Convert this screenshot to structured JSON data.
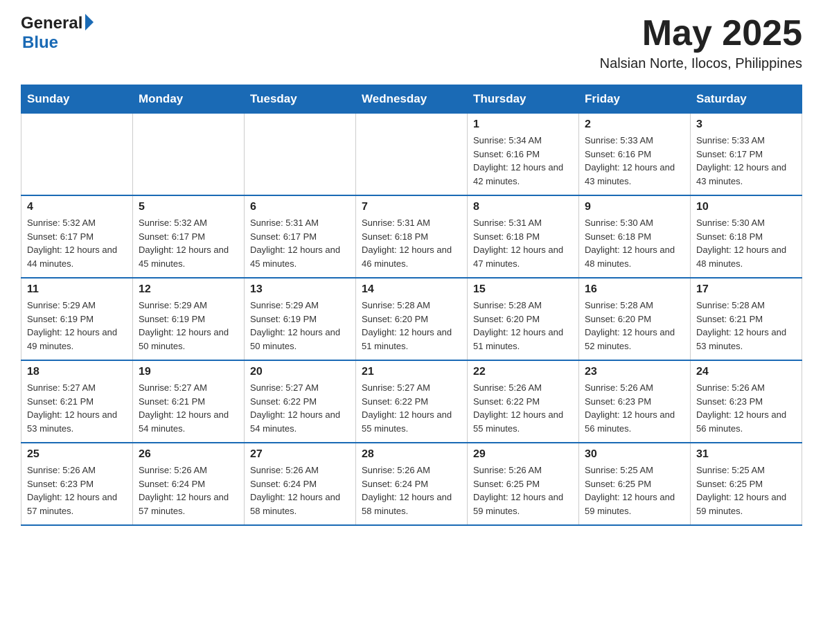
{
  "header": {
    "logo_general": "General",
    "logo_blue": "Blue",
    "month_title": "May 2025",
    "location": "Nalsian Norte, Ilocos, Philippines"
  },
  "days_of_week": [
    "Sunday",
    "Monday",
    "Tuesday",
    "Wednesday",
    "Thursday",
    "Friday",
    "Saturday"
  ],
  "weeks": [
    {
      "days": [
        {
          "number": "",
          "info": ""
        },
        {
          "number": "",
          "info": ""
        },
        {
          "number": "",
          "info": ""
        },
        {
          "number": "",
          "info": ""
        },
        {
          "number": "1",
          "info": "Sunrise: 5:34 AM\nSunset: 6:16 PM\nDaylight: 12 hours and 42 minutes."
        },
        {
          "number": "2",
          "info": "Sunrise: 5:33 AM\nSunset: 6:16 PM\nDaylight: 12 hours and 43 minutes."
        },
        {
          "number": "3",
          "info": "Sunrise: 5:33 AM\nSunset: 6:17 PM\nDaylight: 12 hours and 43 minutes."
        }
      ]
    },
    {
      "days": [
        {
          "number": "4",
          "info": "Sunrise: 5:32 AM\nSunset: 6:17 PM\nDaylight: 12 hours and 44 minutes."
        },
        {
          "number": "5",
          "info": "Sunrise: 5:32 AM\nSunset: 6:17 PM\nDaylight: 12 hours and 45 minutes."
        },
        {
          "number": "6",
          "info": "Sunrise: 5:31 AM\nSunset: 6:17 PM\nDaylight: 12 hours and 45 minutes."
        },
        {
          "number": "7",
          "info": "Sunrise: 5:31 AM\nSunset: 6:18 PM\nDaylight: 12 hours and 46 minutes."
        },
        {
          "number": "8",
          "info": "Sunrise: 5:31 AM\nSunset: 6:18 PM\nDaylight: 12 hours and 47 minutes."
        },
        {
          "number": "9",
          "info": "Sunrise: 5:30 AM\nSunset: 6:18 PM\nDaylight: 12 hours and 48 minutes."
        },
        {
          "number": "10",
          "info": "Sunrise: 5:30 AM\nSunset: 6:18 PM\nDaylight: 12 hours and 48 minutes."
        }
      ]
    },
    {
      "days": [
        {
          "number": "11",
          "info": "Sunrise: 5:29 AM\nSunset: 6:19 PM\nDaylight: 12 hours and 49 minutes."
        },
        {
          "number": "12",
          "info": "Sunrise: 5:29 AM\nSunset: 6:19 PM\nDaylight: 12 hours and 50 minutes."
        },
        {
          "number": "13",
          "info": "Sunrise: 5:29 AM\nSunset: 6:19 PM\nDaylight: 12 hours and 50 minutes."
        },
        {
          "number": "14",
          "info": "Sunrise: 5:28 AM\nSunset: 6:20 PM\nDaylight: 12 hours and 51 minutes."
        },
        {
          "number": "15",
          "info": "Sunrise: 5:28 AM\nSunset: 6:20 PM\nDaylight: 12 hours and 51 minutes."
        },
        {
          "number": "16",
          "info": "Sunrise: 5:28 AM\nSunset: 6:20 PM\nDaylight: 12 hours and 52 minutes."
        },
        {
          "number": "17",
          "info": "Sunrise: 5:28 AM\nSunset: 6:21 PM\nDaylight: 12 hours and 53 minutes."
        }
      ]
    },
    {
      "days": [
        {
          "number": "18",
          "info": "Sunrise: 5:27 AM\nSunset: 6:21 PM\nDaylight: 12 hours and 53 minutes."
        },
        {
          "number": "19",
          "info": "Sunrise: 5:27 AM\nSunset: 6:21 PM\nDaylight: 12 hours and 54 minutes."
        },
        {
          "number": "20",
          "info": "Sunrise: 5:27 AM\nSunset: 6:22 PM\nDaylight: 12 hours and 54 minutes."
        },
        {
          "number": "21",
          "info": "Sunrise: 5:27 AM\nSunset: 6:22 PM\nDaylight: 12 hours and 55 minutes."
        },
        {
          "number": "22",
          "info": "Sunrise: 5:26 AM\nSunset: 6:22 PM\nDaylight: 12 hours and 55 minutes."
        },
        {
          "number": "23",
          "info": "Sunrise: 5:26 AM\nSunset: 6:23 PM\nDaylight: 12 hours and 56 minutes."
        },
        {
          "number": "24",
          "info": "Sunrise: 5:26 AM\nSunset: 6:23 PM\nDaylight: 12 hours and 56 minutes."
        }
      ]
    },
    {
      "days": [
        {
          "number": "25",
          "info": "Sunrise: 5:26 AM\nSunset: 6:23 PM\nDaylight: 12 hours and 57 minutes."
        },
        {
          "number": "26",
          "info": "Sunrise: 5:26 AM\nSunset: 6:24 PM\nDaylight: 12 hours and 57 minutes."
        },
        {
          "number": "27",
          "info": "Sunrise: 5:26 AM\nSunset: 6:24 PM\nDaylight: 12 hours and 58 minutes."
        },
        {
          "number": "28",
          "info": "Sunrise: 5:26 AM\nSunset: 6:24 PM\nDaylight: 12 hours and 58 minutes."
        },
        {
          "number": "29",
          "info": "Sunrise: 5:26 AM\nSunset: 6:25 PM\nDaylight: 12 hours and 59 minutes."
        },
        {
          "number": "30",
          "info": "Sunrise: 5:25 AM\nSunset: 6:25 PM\nDaylight: 12 hours and 59 minutes."
        },
        {
          "number": "31",
          "info": "Sunrise: 5:25 AM\nSunset: 6:25 PM\nDaylight: 12 hours and 59 minutes."
        }
      ]
    }
  ]
}
